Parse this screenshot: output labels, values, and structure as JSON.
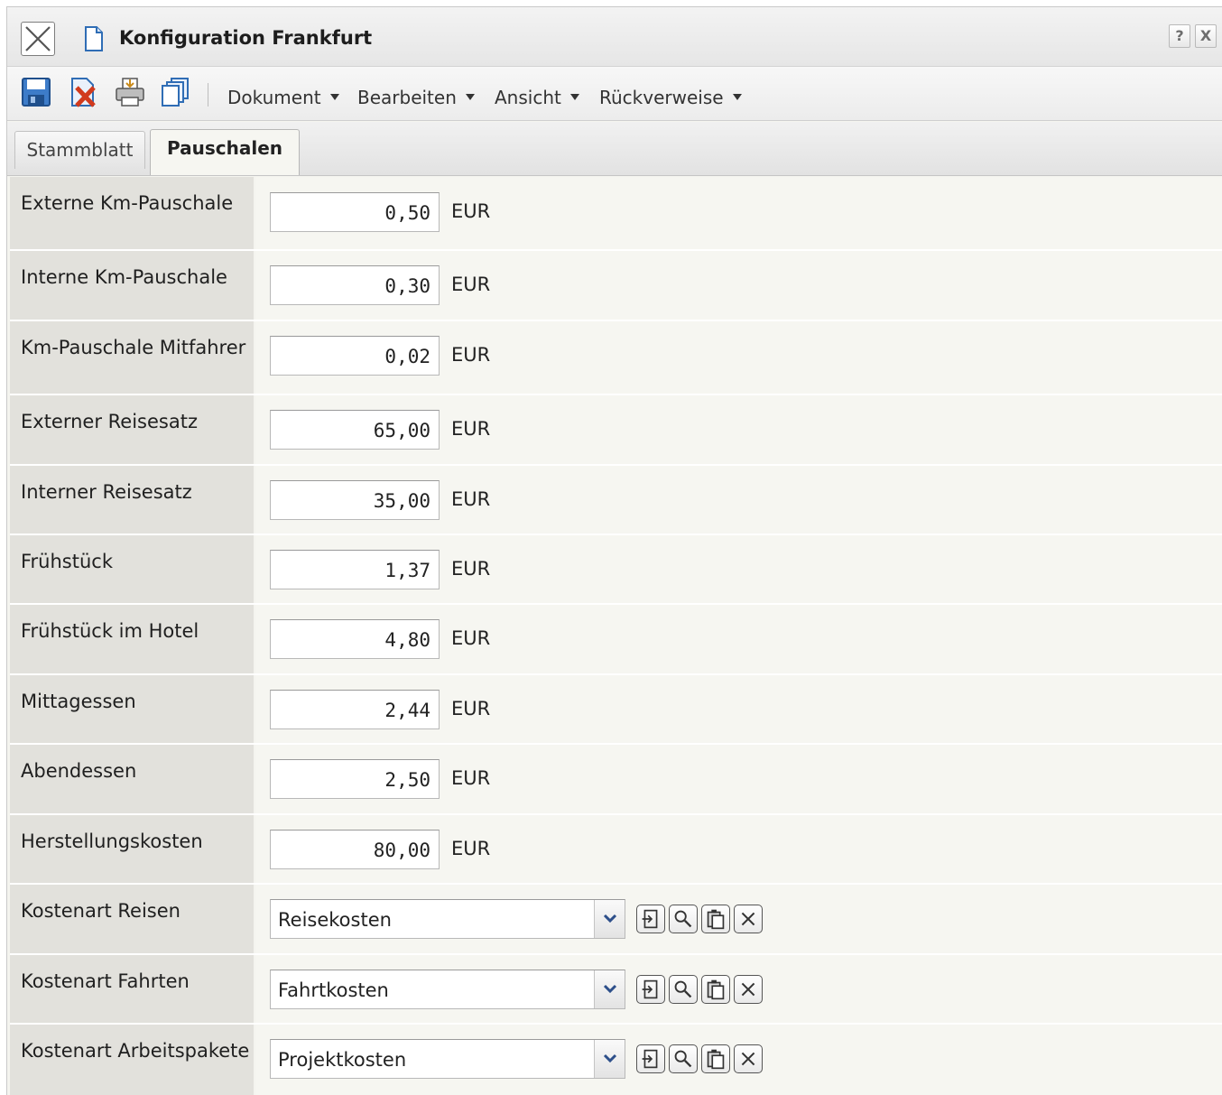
{
  "window": {
    "title": "Konfiguration Frankfurt",
    "help_label": "?",
    "close_label": "X"
  },
  "toolbar": {
    "icons": [
      "save-icon",
      "delete-document-icon",
      "print-icon",
      "copy-icon"
    ],
    "menus": [
      {
        "label": "Dokument"
      },
      {
        "label": "Bearbeiten"
      },
      {
        "label": "Ansicht"
      },
      {
        "label": "Rückverweise"
      }
    ]
  },
  "tabs": [
    {
      "label": "Stammblatt",
      "active": false
    },
    {
      "label": "Pauschalen",
      "active": true
    }
  ],
  "fields": [
    {
      "label": "Externe Km-Pauschale",
      "value": "0,50",
      "unit": "EUR"
    },
    {
      "label": "Interne Km-Pauschale",
      "value": "0,30",
      "unit": "EUR"
    },
    {
      "label": "Km-Pauschale Mitfahrer",
      "value": "0,02",
      "unit": "EUR"
    },
    {
      "label": "Externer Reisesatz",
      "value": "65,00",
      "unit": "EUR"
    },
    {
      "label": "Interner Reisesatz",
      "value": "35,00",
      "unit": "EUR"
    },
    {
      "label": "Frühstück",
      "value": "1,37",
      "unit": "EUR"
    },
    {
      "label": "Frühstück im Hotel",
      "value": "4,80",
      "unit": "EUR"
    },
    {
      "label": "Mittagessen",
      "value": "2,44",
      "unit": "EUR"
    },
    {
      "label": "Abendessen",
      "value": "2,50",
      "unit": "EUR"
    },
    {
      "label": "Herstellungskosten",
      "value": "80,00",
      "unit": "EUR"
    }
  ],
  "selects": [
    {
      "label": "Kostenart Reisen",
      "value": "Reisekosten"
    },
    {
      "label": "Kostenart Fahrten",
      "value": "Fahrtkosten"
    },
    {
      "label": "Kostenart Arbeitspakete",
      "value": "Projektkosten"
    }
  ],
  "select_actions": [
    "open-reference-icon",
    "search-icon",
    "paste-icon",
    "clear-icon"
  ],
  "colors": {
    "label_bg": "#e2e1dc",
    "value_bg": "#f6f6f1",
    "icon_blue": "#2f6db5",
    "icon_red": "#d13a1d"
  }
}
